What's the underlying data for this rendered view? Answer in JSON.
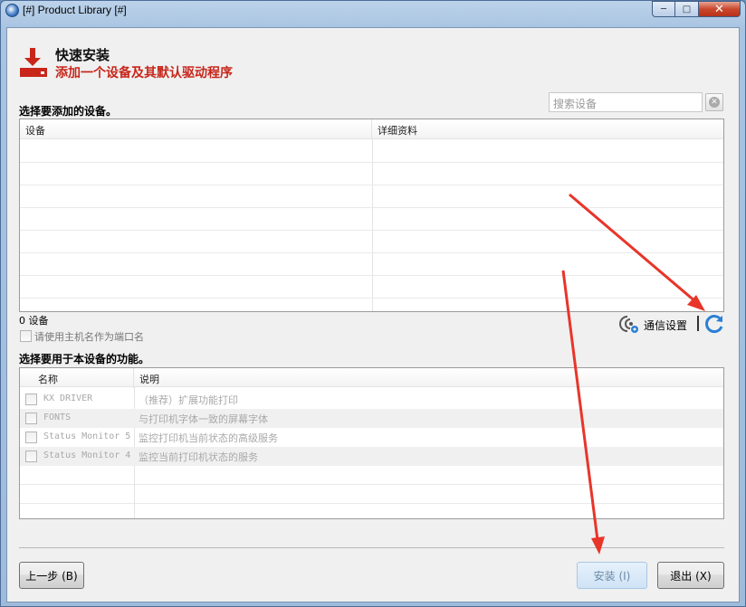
{
  "window": {
    "title": "[#] Product Library [#]",
    "controls": {
      "minimize": "─",
      "maximize": "□",
      "close": "✕"
    }
  },
  "header": {
    "title": "快速安装",
    "subtitle": "添加一个设备及其默认驱动程序"
  },
  "devices_section": {
    "label": "选择要添加的设备。",
    "search_placeholder": "搜索设备",
    "columns": [
      "设备",
      "详细资料"
    ],
    "rows": [],
    "count_text": "0 设备",
    "use_hostname_label": "请使用主机名作为端口名",
    "use_hostname_checked": false,
    "comm_settings_label": "通信设置"
  },
  "functions_section": {
    "label": "选择要用于本设备的功能。",
    "columns": [
      "名称",
      "说明"
    ],
    "rows": [
      {
        "name": "KX DRIVER",
        "description": "（推荐）扩展功能打印",
        "checked": false
      },
      {
        "name": "FONTS",
        "description": "与打印机字体一致的屏幕字体",
        "checked": false
      },
      {
        "name": "Status Monitor 5",
        "description": "监控打印机当前状态的高级服务",
        "checked": false
      },
      {
        "name": "Status Monitor 4",
        "description": "监控当前打印机状态的服务",
        "checked": false
      }
    ]
  },
  "footer": {
    "back_label": "上一步 (B)",
    "install_label": "安装 (I)",
    "exit_label": "退出 (X)"
  },
  "colors": {
    "accent_red": "#c8261a",
    "refresh_blue": "#2a7fd4",
    "annotation_arrow": "#e8352a"
  }
}
